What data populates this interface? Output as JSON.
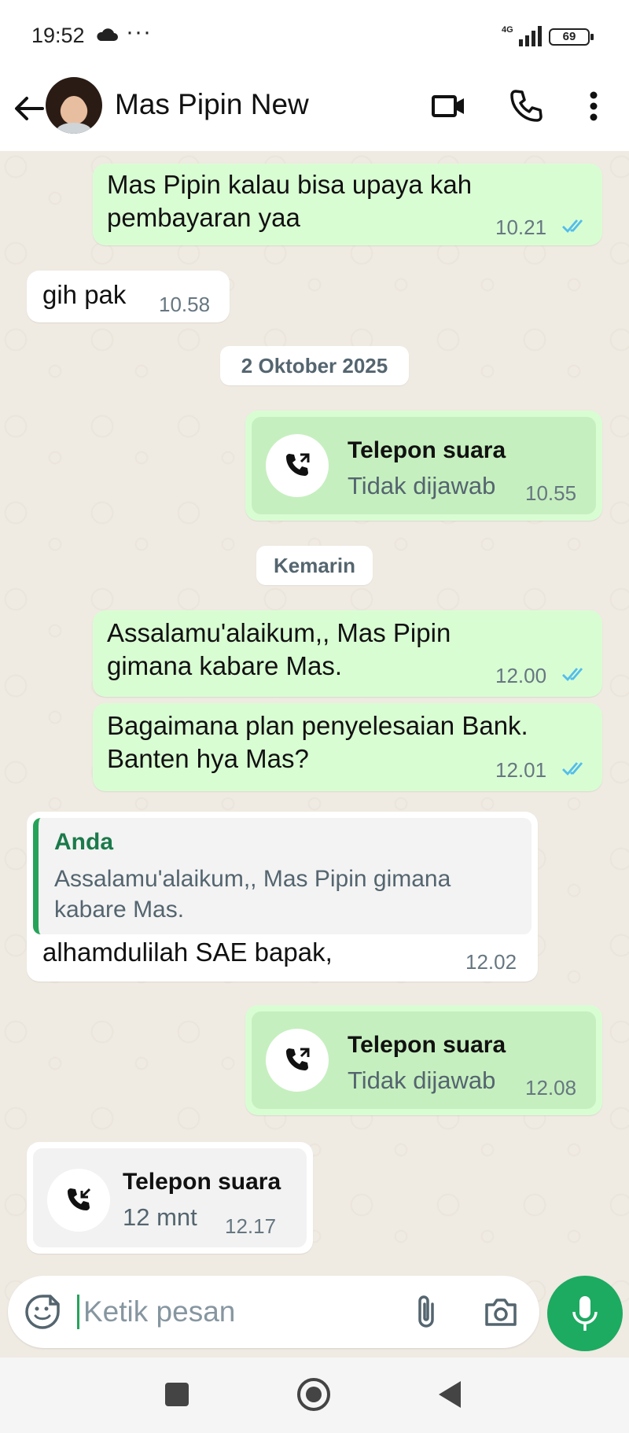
{
  "status_bar": {
    "time": "19:52",
    "dots": "···",
    "network": "4G",
    "battery": "69"
  },
  "header": {
    "contact_name": "Mas Pipin New"
  },
  "messages": [
    {
      "text_line1": "Mas Pipin kalau bisa upaya kah",
      "text_line2": "pembayaran yaa",
      "time": "10.21"
    },
    {
      "text": "gih pak",
      "time": "10.58"
    },
    {
      "date": "2 Oktober 2025"
    },
    {
      "call_title": "Telepon suara",
      "call_status": "Tidak dijawab",
      "time": "10.55"
    },
    {
      "date": "Kemarin"
    },
    {
      "text_line1": "Assalamu'alaikum,, Mas Pipin",
      "text_line2": "gimana kabare Mas.",
      "time": "12.00"
    },
    {
      "text_line1": "Bagaimana plan penyelesaian Bank.",
      "text_line2": "Banten hya Mas?",
      "time": "12.01"
    },
    {
      "quote_author": "Anda",
      "quote_line1": "Assalamu'alaikum,, Mas Pipin gimana",
      "quote_line2": "kabare Mas.",
      "text": "alhamdulilah SAE bapak,",
      "time": "12.02"
    },
    {
      "call_title": "Telepon suara",
      "call_status": "Tidak dijawab",
      "time": "12.08"
    },
    {
      "call_title": "Telepon suara",
      "call_status": "12 mnt",
      "time": "12.17"
    }
  ],
  "composer": {
    "placeholder": "Ketik pesan"
  },
  "colors": {
    "outgoing": "#d9fdd3",
    "incoming": "#ffffff",
    "accent": "#1daa61",
    "read_ticks": "#53bdeb"
  },
  "icons": [
    "back-arrow-icon",
    "video-call-icon",
    "voice-call-icon",
    "more-icon",
    "call-icon",
    "missed-call-icon",
    "incoming-call-icon",
    "emoji-icon",
    "attach-icon",
    "camera-icon",
    "mic-icon"
  ]
}
